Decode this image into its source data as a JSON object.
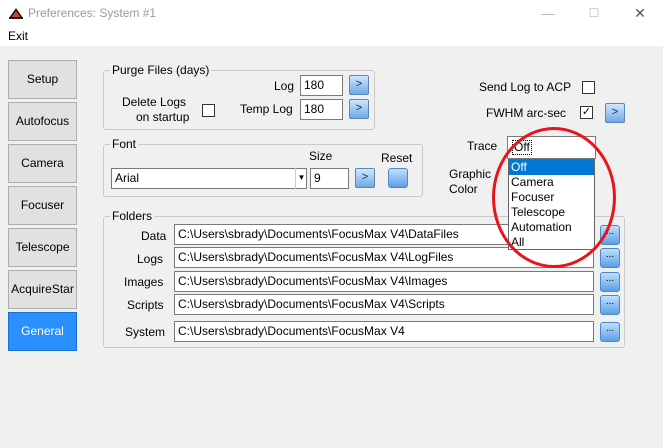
{
  "window": {
    "title": "Preferences: System #1",
    "minimize_glyph": "—",
    "maximize_glyph": "☐",
    "close_glyph": "✕"
  },
  "menu": {
    "exit": "Exit"
  },
  "nav": {
    "items": [
      "Setup",
      "Autofocus",
      "Camera",
      "Focuser",
      "Telescope",
      "AcquireStar",
      "General"
    ],
    "active": "General"
  },
  "purge": {
    "legend": "Purge Files (days)",
    "delete_logs_label_1": "Delete Logs",
    "delete_logs_label_2": "on startup",
    "log_label": "Log",
    "log_value": "180",
    "temp_log_label": "Temp Log",
    "temp_log_value": "180",
    "go_glyph": ">"
  },
  "right_options": {
    "send_log_label": "Send Log to ACP",
    "send_log_checked": false,
    "fwhm_label": "FWHM arc-sec",
    "fwhm_checked": true,
    "checkmark": "✓"
  },
  "font": {
    "legend": "Font",
    "family": "Arial",
    "size_label": "Size",
    "size_value": "9",
    "reset_label": "Reset"
  },
  "trace": {
    "label": "Trace",
    "selected": "Off",
    "options": [
      "Off",
      "Camera",
      "Focuser",
      "Telescope",
      "Automation",
      "All"
    ]
  },
  "graphic_color": {
    "label_1": "Graphic",
    "label_2": "Color"
  },
  "folders": {
    "legend": "Folders",
    "rows": [
      {
        "label": "Data",
        "path": "C:\\Users\\sbrady\\Documents\\FocusMax V4\\DataFiles"
      },
      {
        "label": "Logs",
        "path": "C:\\Users\\sbrady\\Documents\\FocusMax V4\\LogFiles"
      },
      {
        "label": "Images",
        "path": "C:\\Users\\sbrady\\Documents\\FocusMax V4\\Images"
      },
      {
        "label": "Scripts",
        "path": "C:\\Users\\sbrady\\Documents\\FocusMax V4\\Scripts"
      },
      {
        "label": "System",
        "path": "C:\\Users\\sbrady\\Documents\\FocusMax V4"
      }
    ],
    "browse_glyph": "..."
  },
  "colors": {
    "active_nav": "#2a8fff",
    "highlight": "#0078d7",
    "annotation_circle": "#e8141c"
  }
}
